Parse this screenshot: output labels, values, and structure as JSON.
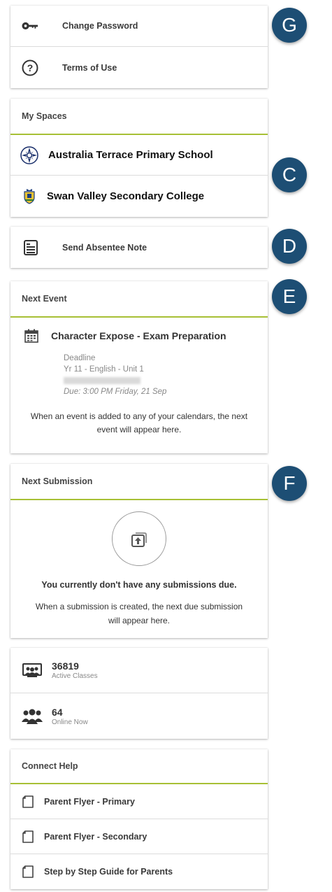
{
  "account": {
    "items": [
      {
        "label": "Change Password",
        "icon": "key-icon"
      },
      {
        "label": "Terms of Use",
        "icon": "question-circle-icon"
      }
    ]
  },
  "spaces": {
    "header": "My Spaces",
    "items": [
      {
        "label": "Australia Terrace Primary School",
        "icon": "school-emblem-icon"
      },
      {
        "label": "Swan Valley Secondary College",
        "icon": "college-crest-icon"
      }
    ]
  },
  "absentee": {
    "label": "Send Absentee Note",
    "icon": "note-icon"
  },
  "next_event": {
    "header": "Next Event",
    "title": "Character Expose - Exam Preparation",
    "type": "Deadline",
    "class": "Yr 11 - English - Unit 1",
    "due": "Due: 3:00 PM Friday, 21 Sep",
    "note": "When an event is added to any of your calendars, the next event will appear here."
  },
  "next_submission": {
    "header": "Next Submission",
    "title": "You currently don't have any submissions due.",
    "note": "When a submission is created, the next due submission will appear here."
  },
  "stats": [
    {
      "value": "36819",
      "label": "Active Classes",
      "icon": "classroom-icon"
    },
    {
      "value": "64",
      "label": "Online Now",
      "icon": "users-icon"
    }
  ],
  "connect_help": {
    "header": "Connect Help",
    "items": [
      {
        "label": "Parent Flyer - Primary"
      },
      {
        "label": "Parent Flyer - Secondary"
      },
      {
        "label": "Step by Step Guide for Parents"
      }
    ]
  },
  "badges": [
    "G",
    "C",
    "D",
    "E",
    "F"
  ],
  "colors": {
    "accent": "#a7c035",
    "badge": "#1d4e74"
  }
}
